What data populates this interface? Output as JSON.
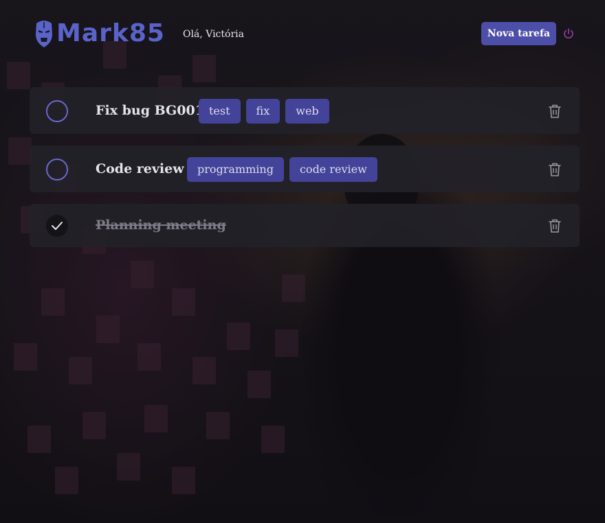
{
  "app": {
    "brand": "Mark85",
    "greeting": "Olá, Victória"
  },
  "header": {
    "new_task_label": "Nova tarefa",
    "logout_icon": "power-icon"
  },
  "tasks": [
    {
      "title": "Fix bug BG001",
      "done": false,
      "tags": [
        "test",
        "fix",
        "web"
      ]
    },
    {
      "title": "Code review",
      "done": false,
      "tags": [
        "programming",
        "code review"
      ]
    },
    {
      "title": "Planning meeting",
      "done": true,
      "tags": []
    }
  ],
  "colors": {
    "accent": "#4d4ea8",
    "tag_bg": "#43439a",
    "checkbox_ring": "#6b68ce",
    "logo": "#5a63c9",
    "power_icon": "#9b3fa0",
    "card_bg": "#222128"
  },
  "icons": {
    "logo": "iron-mask-icon",
    "delete": "trash-icon",
    "complete": "checkmark-icon"
  }
}
